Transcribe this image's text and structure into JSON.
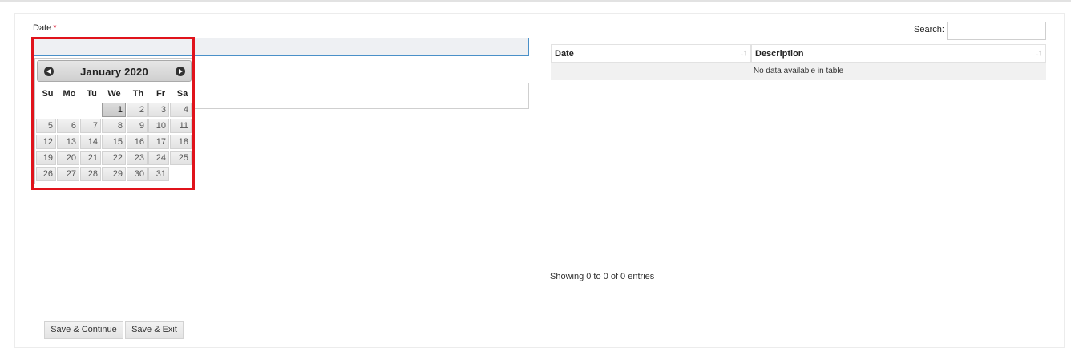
{
  "form": {
    "date_label": "Date",
    "required_marker": "*",
    "date_value": "",
    "description_value": ""
  },
  "calendar": {
    "title": "January 2020",
    "prev_icon": "chevron-left-circle-icon",
    "next_icon": "chevron-right-circle-icon",
    "weekdays": [
      "Su",
      "Mo",
      "Tu",
      "We",
      "Th",
      "Fr",
      "Sa"
    ],
    "weeks": [
      [
        "",
        "",
        "",
        "1",
        "2",
        "3",
        "4"
      ],
      [
        "5",
        "6",
        "7",
        "8",
        "9",
        "10",
        "11"
      ],
      [
        "12",
        "13",
        "14",
        "15",
        "16",
        "17",
        "18"
      ],
      [
        "19",
        "20",
        "21",
        "22",
        "23",
        "24",
        "25"
      ],
      [
        "26",
        "27",
        "28",
        "29",
        "30",
        "31",
        ""
      ]
    ],
    "selected_day": "1",
    "highlight_color": "#e0131b"
  },
  "table": {
    "search_label": "Search:",
    "search_value": "",
    "columns": [
      "Date",
      "Description"
    ],
    "sort_icon": "sort-icon",
    "empty_message": "No data available in table",
    "info": "Showing 0 to 0 of 0 entries"
  },
  "actions": {
    "save_continue": "Save & Continue",
    "save_exit": "Save & Exit"
  }
}
